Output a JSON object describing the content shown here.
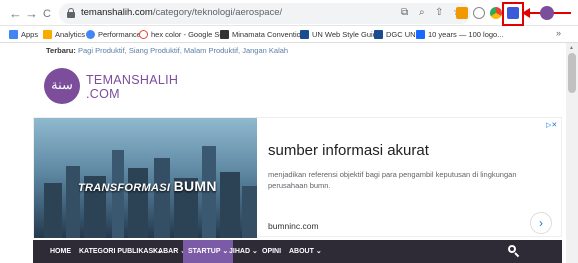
{
  "browser": {
    "url_host": "temanshalih.com",
    "url_path": "/category/teknologi/aerospace/",
    "back_glyph": "←",
    "forward_glyph": "→",
    "reload_glyph": "C",
    "bookmarks": [
      {
        "label": "Apps",
        "icon": "apps-grid-icon",
        "color": "#4285f4"
      },
      {
        "label": "Analytics",
        "icon": "analytics-icon",
        "color": "#f9ab00"
      },
      {
        "label": "Performance",
        "icon": "performance-icon",
        "color": "#4285f4"
      },
      {
        "label": "hex color - Google Se...",
        "icon": "google-icon",
        "color": "#ea4335"
      },
      {
        "label": "Minamata Conventio...",
        "icon": "minamata-icon",
        "color": "#333333"
      },
      {
        "label": "UN Web Style Guide",
        "icon": "un-icon",
        "color": "#1a4d8f"
      },
      {
        "label": "DGC UN",
        "icon": "un-icon",
        "color": "#1a4d8f"
      },
      {
        "label": "10 years — 100 logo...",
        "icon": "behance-icon",
        "color": "#1769ff"
      }
    ],
    "more_bookmarks_glyph": "»"
  },
  "site": {
    "latest_label": "Terbaru:",
    "latest_text": "Pagi Produktif, Siang Produktif, Malam Produktif, Jangan Kalah",
    "logo_text": "سنة",
    "logo_name": "TEMANSHALIH",
    "logo_tld": ".COM"
  },
  "ad": {
    "image_caption_small": "TRANSFORMASI",
    "image_caption_big": "BUMN",
    "headline": "sumber informasi akurat",
    "description": "menjadikan referensi objektif bagi para pengambil keputusan di lingkungan perusahaan bumn.",
    "url": "bumninc.com",
    "chevron": "›",
    "adchoices": "▷✕"
  },
  "menu": {
    "items": [
      {
        "label": "HOME"
      },
      {
        "label": "KATEGORI PUBLIKASI ⌄"
      },
      {
        "label": "KABAR ⌄"
      },
      {
        "label": "STARTUP ⌄",
        "active": true
      },
      {
        "label": "JIHAD ⌄"
      },
      {
        "label": "OPINI"
      },
      {
        "label": "ABOUT ⌄"
      }
    ]
  },
  "colors": {
    "brand_purple": "#7b4d9a",
    "menu_bg": "#2e2b36",
    "active_menu": "#7b5aa6",
    "highlight_red": "#e00000"
  }
}
